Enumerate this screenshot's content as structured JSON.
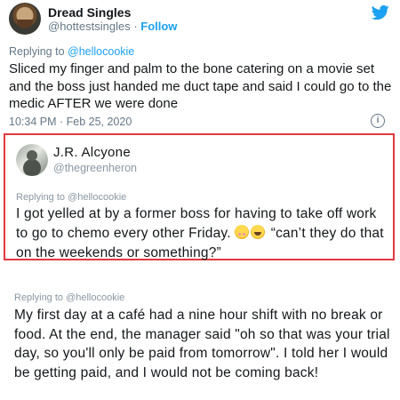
{
  "tweet1": {
    "name": "Dread Singles",
    "handle": "@hottestsingles",
    "separator": " · ",
    "follow_label": "Follow",
    "replying_prefix": "Replying to ",
    "replying_mention": "@hellocookie",
    "text": "Sliced my finger and palm to the bone catering on a movie set and the boss just handed me duct tape and said I could go to the medic AFTER we were done",
    "timestamp": "10:34 PM · Feb 25, 2020",
    "icons": [
      "twitter-bird-icon",
      "info-icon"
    ]
  },
  "tweet2": {
    "name": "J.R. Alcyone",
    "handle": "@thegreenheron",
    "replying": "Replying to @hellocookie",
    "text_before_emoji": "I got yelled at by a former boss for having to take off work to go to chemo every other Friday. ",
    "text_after_emoji": " “can’t they do that on the weekends or something?”",
    "emojis": [
      "flushed-face-icon",
      "tears-of-joy-icon"
    ],
    "border_color": "#e0393e"
  },
  "tweet3": {
    "replying": "Replying to @hellocookie",
    "text": "My first day at a café had a nine hour shift with no break or food. At the end, the manager said \"oh so that was your trial day, so you'll only be paid from tomorrow\". I told her I would be getting paid, and I would not be coming back!"
  },
  "colors": {
    "link": "#1da1f2",
    "secondary_text": "#657786",
    "text": "#14171a"
  }
}
